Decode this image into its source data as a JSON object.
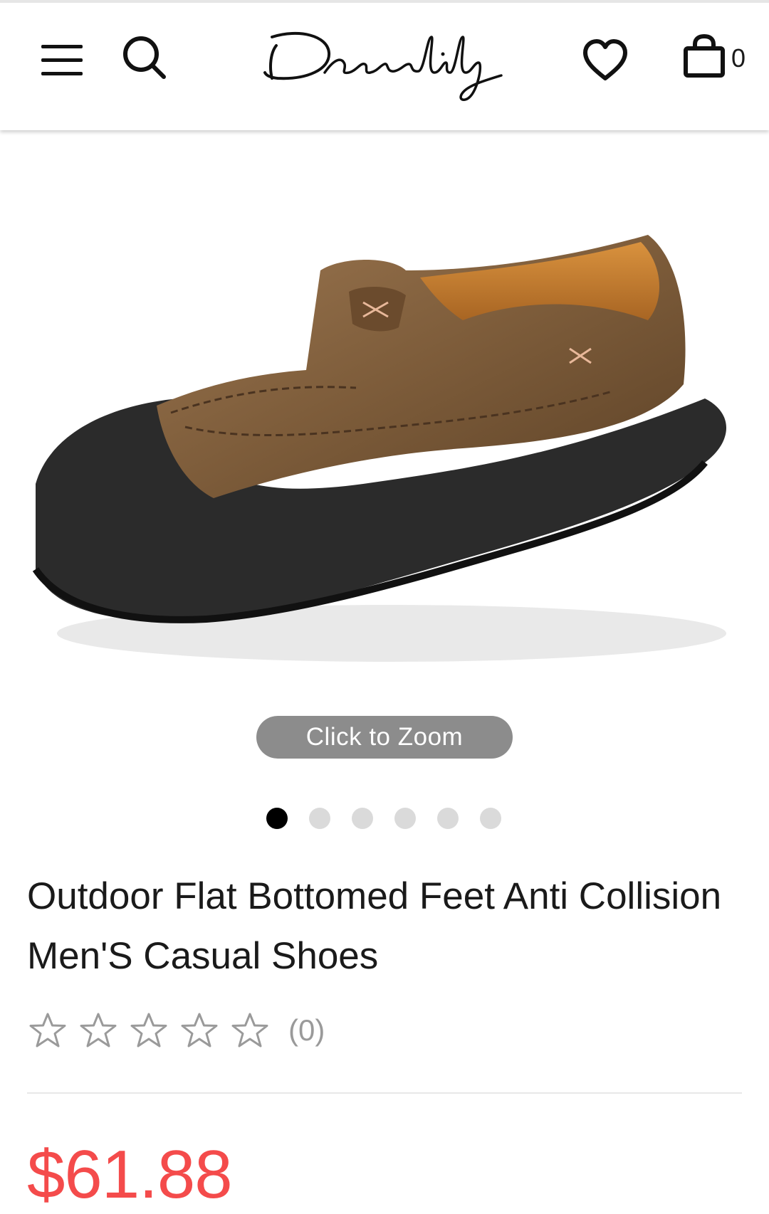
{
  "header": {
    "brand": "Dresslily",
    "cart_count": "0",
    "icons": [
      "menu-icon",
      "search-icon",
      "heart-icon",
      "bag-icon"
    ]
  },
  "gallery": {
    "zoom_label": "Click to Zoom",
    "slide_count": 6,
    "active_index": 0
  },
  "product": {
    "title": "Outdoor Flat Bottomed Feet Anti Collision Men'S Casual Shoes",
    "rating_stars": 0,
    "review_count": "(0)",
    "price": "$61.88"
  },
  "colors": {
    "price": "#f44b4b",
    "zoom_pill": "#8c8c8c",
    "dot_active": "#000000",
    "dot_inactive": "#dadada"
  }
}
